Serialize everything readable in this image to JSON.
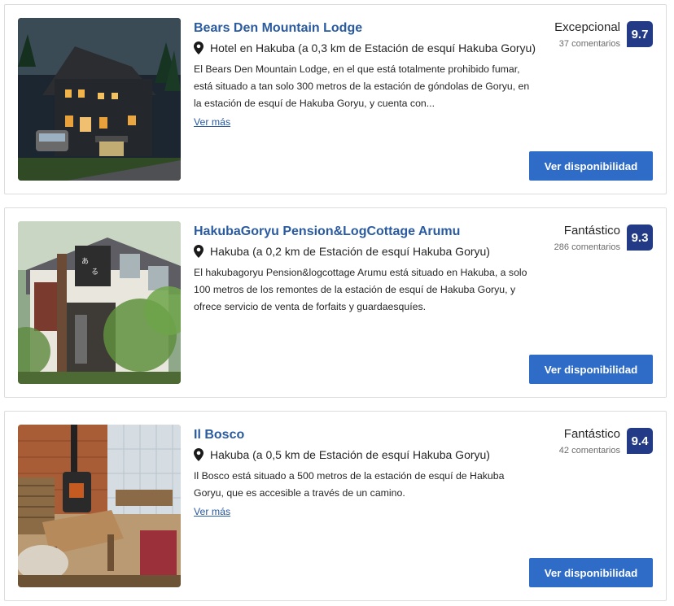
{
  "hotels": [
    {
      "name": "Bears Den Mountain Lodge",
      "location": "Hotel en Hakuba (a 0,3 km de Estación de esquí Hakuba Goryu)",
      "description": "El Bears Den Mountain Lodge, en el que está totalmente prohibido fumar, está situado a tan solo 300 metros de la estación de góndolas de Goryu, en la estación de esquí de Hakuba Goryu, y cuenta con...",
      "more_label": "Ver más",
      "review_word": "Excepcional",
      "review_count": "37 comentarios",
      "score": "9.7",
      "button_label": "Ver disponibilidad",
      "photo_icon": "lodge-night-photo"
    },
    {
      "name": "HakubaGoryu Pension&LogCottage Arumu",
      "location": "Hakuba (a 0,2 km de Estación de esquí Hakuba Goryu)",
      "description": "El hakubagoryu Pension&logcottage Arumu está situado en Hakuba, a solo 100 metros de los remontes de la estación de esquí de Hakuba Goryu, y ofrece servicio de venta de forfaits y guardaesquíes.",
      "review_word": "Fantástico",
      "review_count": "286 comentarios",
      "score": "9.3",
      "button_label": "Ver disponibilidad",
      "photo_icon": "pension-exterior-photo"
    },
    {
      "name": "Il Bosco",
      "location": "Hakuba (a 0,5 km de Estación de esquí Hakuba Goryu)",
      "description": "Il Bosco está situado a 500 metros de la estación de esquí de Hakuba Goryu, que es accesible a través de un camino.",
      "more_label": "Ver más",
      "review_word": "Fantástico",
      "review_count": "42 comentarios",
      "score": "9.4",
      "button_label": "Ver disponibilidad",
      "photo_icon": "interior-stove-photo"
    }
  ],
  "colors": {
    "link": "#2a5a9f",
    "score_bg": "#233b87",
    "button_bg": "#2f6cc7"
  }
}
